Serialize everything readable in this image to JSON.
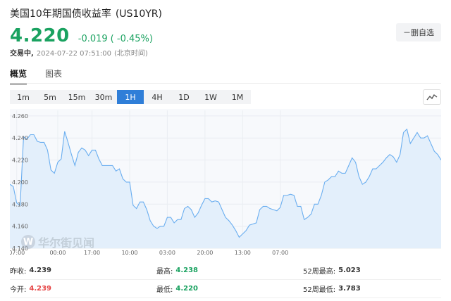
{
  "header": {
    "title": "美国10年期国债收益率",
    "code": "(US10YR)",
    "price": "4.220",
    "change": "-0.019",
    "change_pct": "( -0.45%)",
    "status": "交易中,",
    "time": "2024-07-22 07:51:00",
    "timezone": "(北京时间)"
  },
  "fav_button": "－删自选",
  "tabs": [
    {
      "label": "概览",
      "active": true
    },
    {
      "label": "图表",
      "active": false
    }
  ],
  "periods": [
    {
      "label": "1m",
      "active": false
    },
    {
      "label": "5m",
      "active": false
    },
    {
      "label": "15m",
      "active": false
    },
    {
      "label": "30m",
      "active": false
    },
    {
      "label": "1H",
      "active": true
    },
    {
      "label": "4H",
      "active": false
    },
    {
      "label": "1D",
      "active": false
    },
    {
      "label": "1W",
      "active": false
    },
    {
      "label": "1M",
      "active": false
    }
  ],
  "chart_type_icon": "line-chart-icon",
  "watermark": {
    "text": "华尔街见闻",
    "icon_letter": "W"
  },
  "colors": {
    "line": "#6aaef0",
    "area": "#e3effb",
    "up": "#e64545",
    "down": "#1aa260",
    "accent": "#2f7ed8"
  },
  "chart_data": {
    "type": "area",
    "ylim": [
      4.14,
      4.265
    ],
    "y_ticks": [
      4.26,
      4.24,
      4.22,
      4.2,
      4.18,
      4.16,
      4.14
    ],
    "y_tick_labels": [
      "4.260",
      "4.240",
      "4.220",
      "4.200",
      "4.180",
      "4.160",
      "4.140"
    ],
    "x_tick_labels": [
      {
        "i": 2,
        "label": "07:00"
      },
      {
        "i": 14,
        "label": "00:00"
      },
      {
        "i": 24,
        "label": "17:00"
      },
      {
        "i": 35,
        "label": "10:00"
      },
      {
        "i": 46,
        "label": "03:00"
      },
      {
        "i": 57,
        "label": "20:00"
      },
      {
        "i": 68,
        "label": "13:00"
      },
      {
        "i": 79,
        "label": "07:00"
      }
    ],
    "values": [
      4.198,
      4.196,
      4.181,
      4.179,
      4.241,
      4.239,
      4.243,
      4.243,
      4.237,
      4.236,
      4.236,
      4.229,
      4.211,
      4.208,
      4.218,
      4.221,
      4.246,
      4.236,
      4.225,
      4.215,
      4.227,
      4.231,
      4.229,
      4.224,
      4.229,
      4.229,
      4.221,
      4.215,
      4.215,
      4.215,
      4.215,
      4.21,
      4.212,
      4.203,
      4.2,
      4.2,
      4.179,
      4.176,
      4.182,
      4.182,
      4.175,
      4.165,
      4.16,
      4.158,
      4.16,
      4.16,
      4.168,
      4.168,
      4.163,
      4.166,
      4.166,
      4.176,
      4.178,
      4.175,
      4.168,
      4.172,
      4.179,
      4.185,
      4.185,
      4.182,
      4.183,
      4.182,
      4.175,
      4.168,
      4.165,
      4.161,
      4.156,
      4.15,
      4.153,
      4.156,
      4.161,
      4.162,
      4.163,
      4.175,
      4.178,
      4.178,
      4.176,
      4.175,
      4.174,
      4.177,
      4.188,
      4.188,
      4.189,
      4.188,
      4.178,
      4.178,
      4.166,
      4.168,
      4.171,
      4.18,
      4.18,
      4.188,
      4.2,
      4.202,
      4.205,
      4.205,
      4.21,
      4.208,
      4.208,
      4.215,
      4.222,
      4.218,
      4.205,
      4.198,
      4.2,
      4.205,
      4.212,
      4.212,
      4.215,
      4.218,
      4.222,
      4.225,
      4.223,
      4.218,
      4.225,
      4.245,
      4.248,
      4.235,
      4.24,
      4.245,
      4.24,
      4.24,
      4.242,
      4.235,
      4.228,
      4.225,
      4.22
    ]
  },
  "stats": [
    [
      {
        "label": "昨收:",
        "value": "4.239",
        "tone": "dark"
      },
      {
        "label": "最高:",
        "value": "4.238",
        "tone": "green"
      },
      {
        "label": "52周最高:",
        "value": "5.023",
        "tone": "dark"
      }
    ],
    [
      {
        "label": "今开:",
        "value": "4.239",
        "tone": "red"
      },
      {
        "label": "最低:",
        "value": "4.220",
        "tone": "green"
      },
      {
        "label": "52周最低:",
        "value": "3.783",
        "tone": "dark"
      }
    ]
  ]
}
